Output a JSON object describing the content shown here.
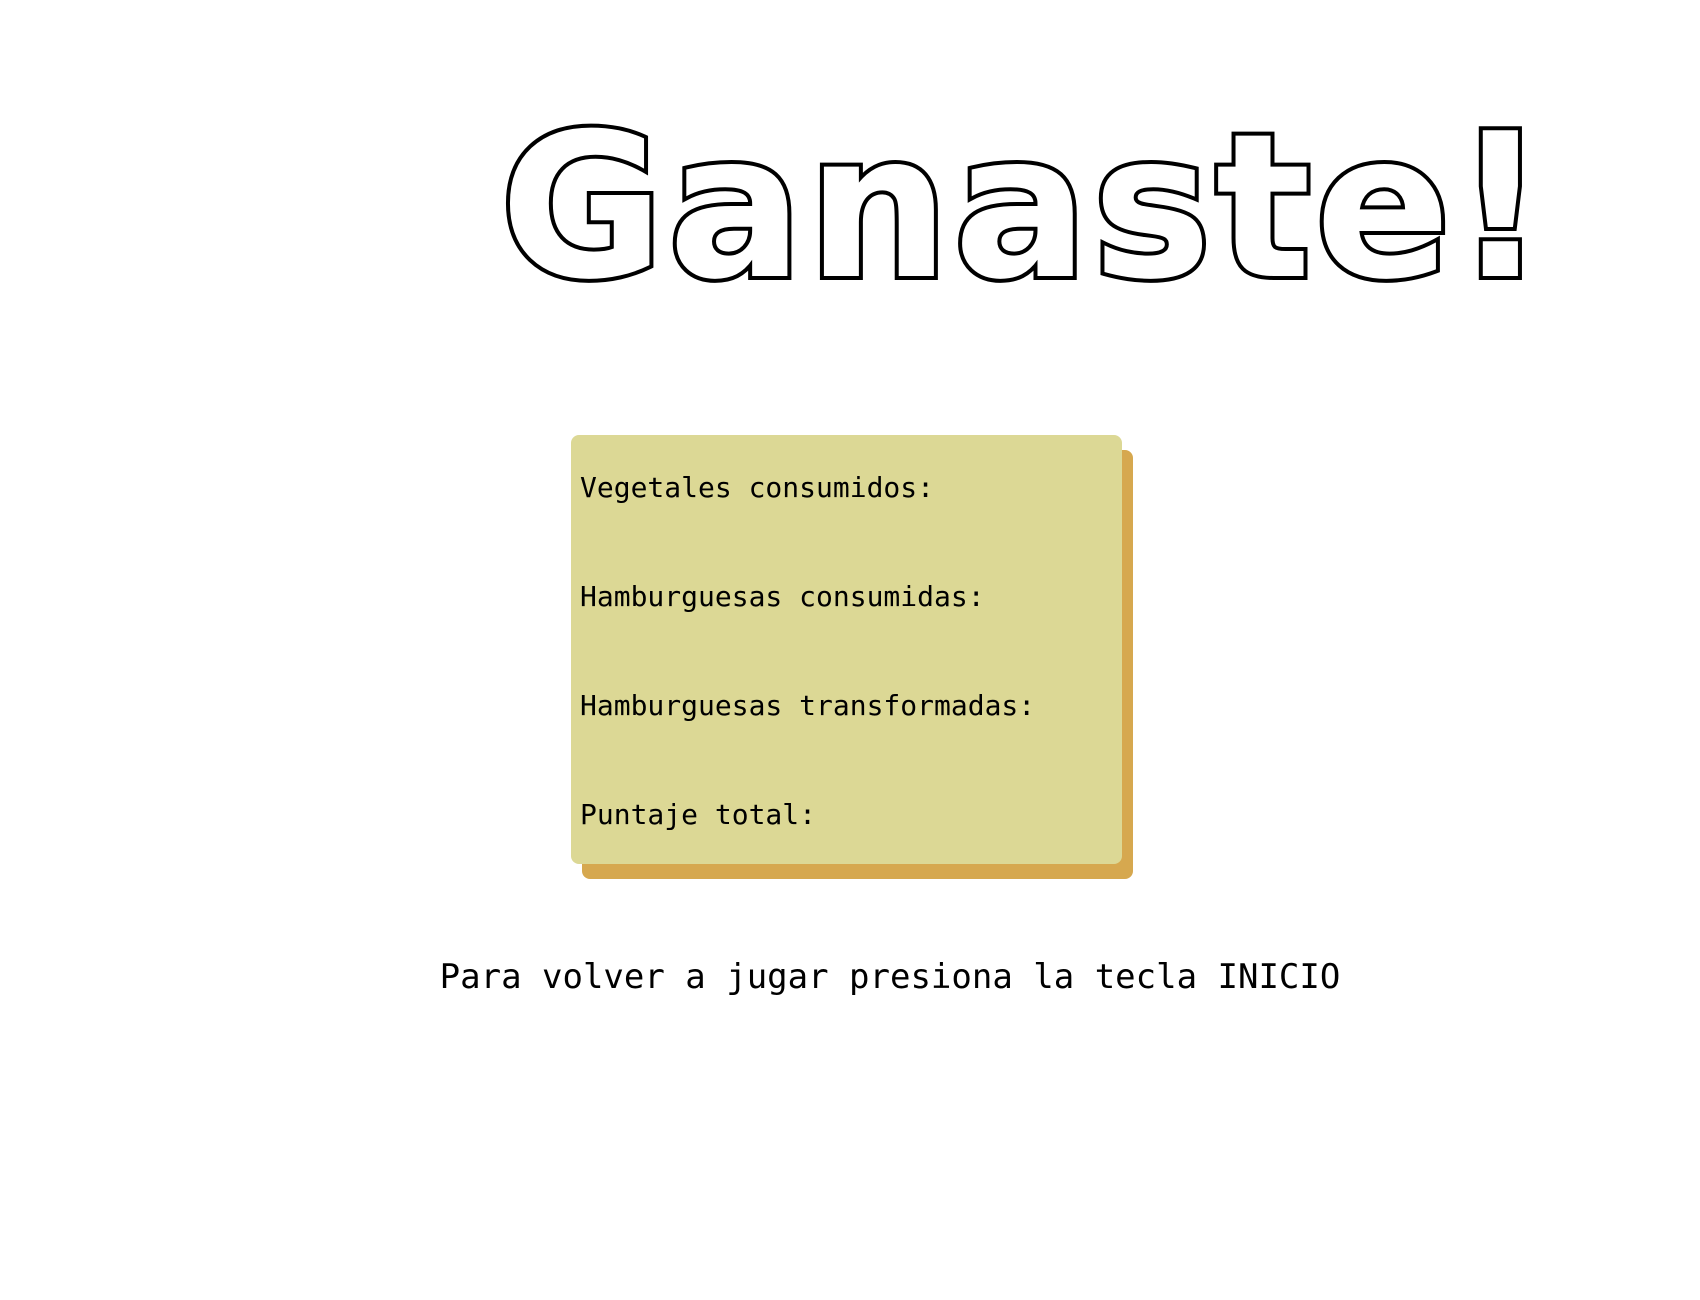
{
  "title": "Ganaste!",
  "stats": {
    "vegetables_label": "Vegetales consumidos:",
    "vegetables_value": "",
    "burgers_eaten_label": "Hamburguesas consumidas:",
    "burgers_eaten_value": "",
    "burgers_transformed_label": "Hamburguesas transformadas:",
    "burgers_transformed_value": "",
    "total_score_label": "Puntaje total:",
    "total_score_value": ""
  },
  "restart_hint": "Para volver a jugar presiona la tecla INICIO",
  "colors": {
    "background": "#ffffff",
    "panel": "#dcd895",
    "panel_shadow": "#d6a84f",
    "text": "#000000"
  }
}
